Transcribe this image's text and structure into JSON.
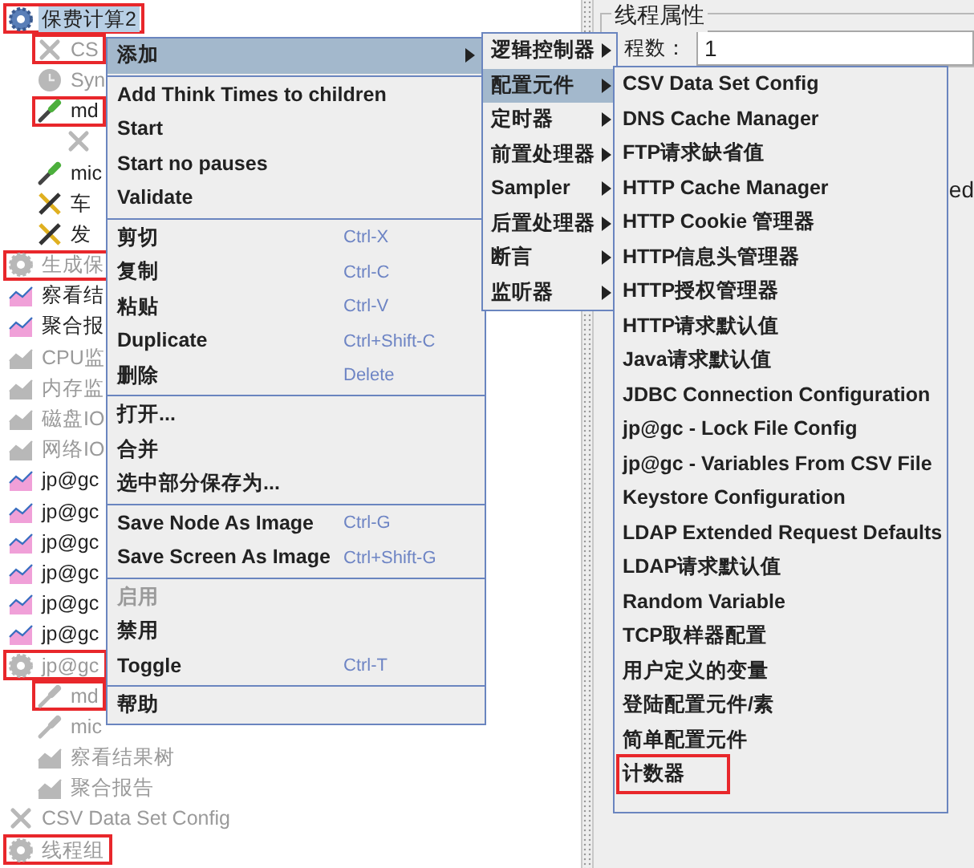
{
  "tree": [
    {
      "label": "保费计算2",
      "kind": "gear",
      "selected": true,
      "disabled": false,
      "marked": true,
      "children": [
        {
          "label": "CS",
          "kind": "wrench",
          "selected": false,
          "disabled": true,
          "marked": true
        },
        {
          "label": "Syn",
          "kind": "clock",
          "selected": false,
          "disabled": true,
          "marked": false
        },
        {
          "label": "md",
          "kind": "pipette",
          "selected": false,
          "disabled": false,
          "marked": true,
          "children": [
            {
              "kind": "wrench",
              "selected": false,
              "disabled": true,
              "marked": false
            }
          ]
        },
        {
          "label": "mic",
          "kind": "pipette",
          "selected": false,
          "disabled": false,
          "marked": false
        },
        {
          "label": "车",
          "kind": "tools",
          "selected": false,
          "disabled": false,
          "marked": false
        },
        {
          "label": "发",
          "kind": "tools",
          "selected": false,
          "disabled": false,
          "marked": false
        }
      ]
    },
    {
      "label": "生成保",
      "kind": "gear",
      "selected": false,
      "disabled": true,
      "marked": true
    },
    {
      "label": "察看结",
      "kind": "chart",
      "selected": false,
      "disabled": false,
      "marked": false
    },
    {
      "label": "聚合报",
      "kind": "chart",
      "selected": false,
      "disabled": false,
      "marked": false
    },
    {
      "label": "CPU监",
      "kind": "chart",
      "selected": false,
      "disabled": true,
      "marked": false
    },
    {
      "label": "内存监",
      "kind": "chart",
      "selected": false,
      "disabled": true,
      "marked": false
    },
    {
      "label": "磁盘IO",
      "kind": "chart",
      "selected": false,
      "disabled": true,
      "marked": false
    },
    {
      "label": "网络IO",
      "kind": "chart",
      "selected": false,
      "disabled": true,
      "marked": false
    },
    {
      "label": "jp@gc",
      "kind": "chart",
      "selected": false,
      "disabled": false,
      "marked": false
    },
    {
      "label": "jp@gc",
      "kind": "chart",
      "selected": false,
      "disabled": false,
      "marked": false
    },
    {
      "label": "jp@gc",
      "kind": "chart",
      "selected": false,
      "disabled": false,
      "marked": false
    },
    {
      "label": "jp@gc",
      "kind": "chart",
      "selected": false,
      "disabled": false,
      "marked": false
    },
    {
      "label": "jp@gc",
      "kind": "chart",
      "selected": false,
      "disabled": false,
      "marked": false
    },
    {
      "label": "jp@gc",
      "kind": "chart",
      "selected": false,
      "disabled": false,
      "marked": false
    },
    {
      "label": "jp@gc",
      "kind": "gear",
      "selected": false,
      "disabled": true,
      "marked": true,
      "children": [
        {
          "label": "md",
          "kind": "pipette",
          "selected": false,
          "disabled": true,
          "marked": true
        },
        {
          "label": "mic",
          "kind": "pipette",
          "selected": false,
          "disabled": true,
          "marked": false
        },
        {
          "label": "察看结果树",
          "kind": "chart",
          "selected": false,
          "disabled": true,
          "marked": false
        },
        {
          "label": "聚合报告",
          "kind": "chart",
          "selected": false,
          "disabled": true,
          "marked": false
        }
      ]
    },
    {
      "label": "CSV Data Set Config",
      "kind": "wrench",
      "selected": false,
      "disabled": true,
      "marked": false
    },
    {
      "label": "线程组",
      "kind": "gear",
      "selected": false,
      "disabled": true,
      "marked": true
    }
  ],
  "settings_panel": {
    "group_title": "线程属性",
    "threads_label": "程数：",
    "threads_value": "1",
    "partial_text": "ed"
  },
  "context_menu": [
    {
      "kind": "item",
      "label": "添加",
      "submenu": true,
      "selected": true,
      "disabled": false
    },
    {
      "kind": "separator"
    },
    {
      "kind": "item",
      "label": "Add Think Times to children",
      "submenu": false,
      "selected": false,
      "disabled": false
    },
    {
      "kind": "item",
      "label": "Start",
      "submenu": false,
      "selected": false,
      "disabled": false
    },
    {
      "kind": "item",
      "label": "Start no pauses",
      "submenu": false,
      "selected": false,
      "disabled": false
    },
    {
      "kind": "item",
      "label": "Validate",
      "submenu": false,
      "selected": false,
      "disabled": false
    },
    {
      "kind": "separator"
    },
    {
      "kind": "item",
      "label": "剪切",
      "shortcut": "Ctrl-X",
      "submenu": false,
      "selected": false,
      "disabled": false
    },
    {
      "kind": "item",
      "label": "复制",
      "shortcut": "Ctrl-C",
      "submenu": false,
      "selected": false,
      "disabled": false
    },
    {
      "kind": "item",
      "label": "粘贴",
      "shortcut": "Ctrl-V",
      "submenu": false,
      "selected": false,
      "disabled": false
    },
    {
      "kind": "item",
      "label": "Duplicate",
      "shortcut": "Ctrl+Shift-C",
      "submenu": false,
      "selected": false,
      "disabled": false
    },
    {
      "kind": "item",
      "label": "删除",
      "shortcut": "Delete",
      "submenu": false,
      "selected": false,
      "disabled": false
    },
    {
      "kind": "separator"
    },
    {
      "kind": "item",
      "label": "打开...",
      "submenu": false,
      "selected": false,
      "disabled": false
    },
    {
      "kind": "item",
      "label": "合并",
      "submenu": false,
      "selected": false,
      "disabled": false
    },
    {
      "kind": "item",
      "label": "选中部分保存为...",
      "submenu": false,
      "selected": false,
      "disabled": false
    },
    {
      "kind": "separator"
    },
    {
      "kind": "item",
      "label": "Save Node As Image",
      "shortcut": "Ctrl-G",
      "submenu": false,
      "selected": false,
      "disabled": false
    },
    {
      "kind": "item",
      "label": "Save Screen As Image",
      "shortcut": "Ctrl+Shift-G",
      "submenu": false,
      "selected": false,
      "disabled": false
    },
    {
      "kind": "separator"
    },
    {
      "kind": "item",
      "label": "启用",
      "submenu": false,
      "selected": false,
      "disabled": true
    },
    {
      "kind": "item",
      "label": "禁用",
      "submenu": false,
      "selected": false,
      "disabled": false
    },
    {
      "kind": "item",
      "label": "Toggle",
      "shortcut": "Ctrl-T",
      "submenu": false,
      "selected": false,
      "disabled": false
    },
    {
      "kind": "separator"
    },
    {
      "kind": "item",
      "label": "帮助",
      "submenu": false,
      "selected": false,
      "disabled": false
    }
  ],
  "add_submenu": [
    {
      "label": "逻辑控制器",
      "submenu": true,
      "selected": false
    },
    {
      "label": "配置元件",
      "submenu": true,
      "selected": true
    },
    {
      "label": "定时器",
      "submenu": true,
      "selected": false
    },
    {
      "label": "前置处理器",
      "submenu": true,
      "selected": false
    },
    {
      "label": "Sampler",
      "submenu": true,
      "selected": false
    },
    {
      "label": "后置处理器",
      "submenu": true,
      "selected": false
    },
    {
      "label": "断言",
      "submenu": true,
      "selected": false
    },
    {
      "label": "监听器",
      "submenu": true,
      "selected": false
    }
  ],
  "config_submenu": [
    {
      "label": "CSV Data Set Config",
      "marked": false
    },
    {
      "label": "DNS Cache Manager",
      "marked": false
    },
    {
      "label": "FTP请求缺省值",
      "marked": false
    },
    {
      "label": "HTTP Cache Manager",
      "marked": false
    },
    {
      "label": "HTTP Cookie 管理器",
      "marked": false
    },
    {
      "label": "HTTP信息头管理器",
      "marked": false
    },
    {
      "label": "HTTP授权管理器",
      "marked": false
    },
    {
      "label": "HTTP请求默认值",
      "marked": false
    },
    {
      "label": "Java请求默认值",
      "marked": false
    },
    {
      "label": "JDBC Connection Configuration",
      "marked": false
    },
    {
      "label": "jp@gc - Lock File Config",
      "marked": false
    },
    {
      "label": "jp@gc - Variables From CSV File",
      "marked": false
    },
    {
      "label": "Keystore Configuration",
      "marked": false
    },
    {
      "label": "LDAP Extended Request Defaults",
      "marked": false
    },
    {
      "label": "LDAP请求默认值",
      "marked": false
    },
    {
      "label": "Random Variable",
      "marked": false
    },
    {
      "label": "TCP取样器配置",
      "marked": false
    },
    {
      "label": "用户定义的变量",
      "marked": false
    },
    {
      "label": "登陆配置元件/素",
      "marked": false
    },
    {
      "label": "简单配置元件",
      "marked": false
    },
    {
      "label": "计数器",
      "marked": true
    }
  ]
}
